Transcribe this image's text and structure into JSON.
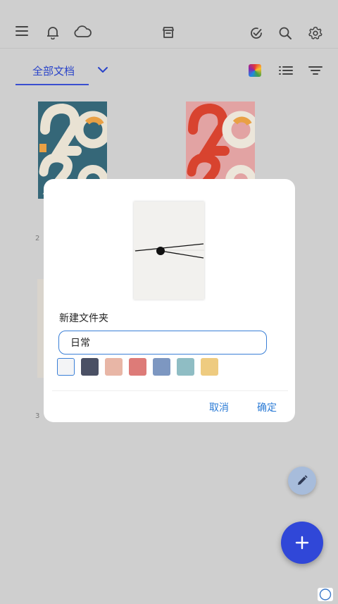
{
  "header": {
    "icons": [
      "menu-icon",
      "bell-icon",
      "cloud-icon",
      "store-icon",
      "check-circle-icon",
      "search-icon",
      "gear-icon"
    ]
  },
  "tabs": {
    "active_label": "全部文档",
    "accent": "#2a44c9"
  },
  "background_items": {
    "caption_1": "2",
    "caption_2": "3"
  },
  "dialog": {
    "title": "新建文件夹",
    "name_value": "日常",
    "name_placeholder": "",
    "colors": [
      "#f3f4f6",
      "#4a5064",
      "#e8b6a6",
      "#dd7b78",
      "#7d97c1",
      "#8fbdc4",
      "#eecb80"
    ],
    "selected_color_index": 0,
    "cancel_label": "取消",
    "confirm_label": "确定",
    "button_color": "#2b7bd6"
  },
  "fab": {
    "add_color": "#3047d8",
    "edit_color": "#a7bcdb"
  }
}
